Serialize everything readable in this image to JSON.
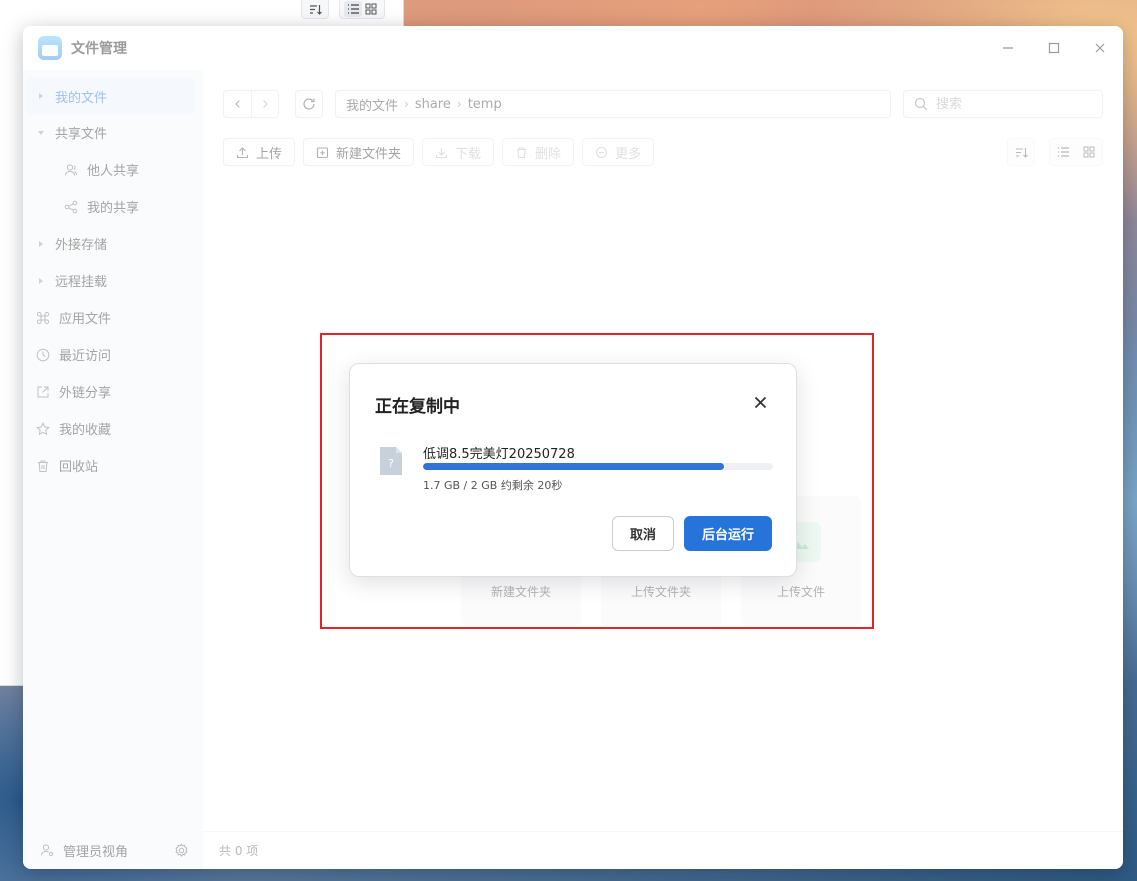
{
  "window": {
    "title": "文件管理",
    "controls": [
      "minimize",
      "maximize",
      "close"
    ]
  },
  "sidebar": {
    "items": [
      {
        "label": "我的文件",
        "type": "collapsible",
        "active": true
      },
      {
        "label": "共享文件",
        "type": "expanded"
      },
      {
        "label": "他人共享",
        "type": "sub",
        "icon": "users-icon"
      },
      {
        "label": "我的共享",
        "type": "sub",
        "icon": "share-icon"
      },
      {
        "label": "外接存储",
        "type": "collapsible"
      },
      {
        "label": "远程挂载",
        "type": "collapsible"
      },
      {
        "label": "应用文件",
        "icon": "command-icon"
      },
      {
        "label": "最近访问",
        "icon": "clock-icon"
      },
      {
        "label": "外链分享",
        "icon": "external-link-icon"
      },
      {
        "label": "我的收藏",
        "icon": "star-icon"
      },
      {
        "label": "回收站",
        "icon": "trash-icon"
      }
    ],
    "footer_label": "管理员视角"
  },
  "path": [
    "我的文件",
    "share",
    "temp"
  ],
  "search": {
    "placeholder": "搜索"
  },
  "toolbar": {
    "upload": "上传",
    "new_folder": "新建文件夹",
    "download": "下载",
    "delete": "删除",
    "more": "更多"
  },
  "empty_actions": [
    "新建文件夹",
    "上传文件夹",
    "上传文件"
  ],
  "status": "共 0 项",
  "dialog": {
    "title": "正在复制中",
    "file_name": "低调8.5完美灯20250728",
    "progress": 0.86,
    "progress_text": "1.7 GB / 2 GB 约剩余 20秒",
    "cancel": "取消",
    "background": "后台运行"
  },
  "colors": {
    "accent": "#2673d9",
    "highlight": "#e0262b"
  }
}
